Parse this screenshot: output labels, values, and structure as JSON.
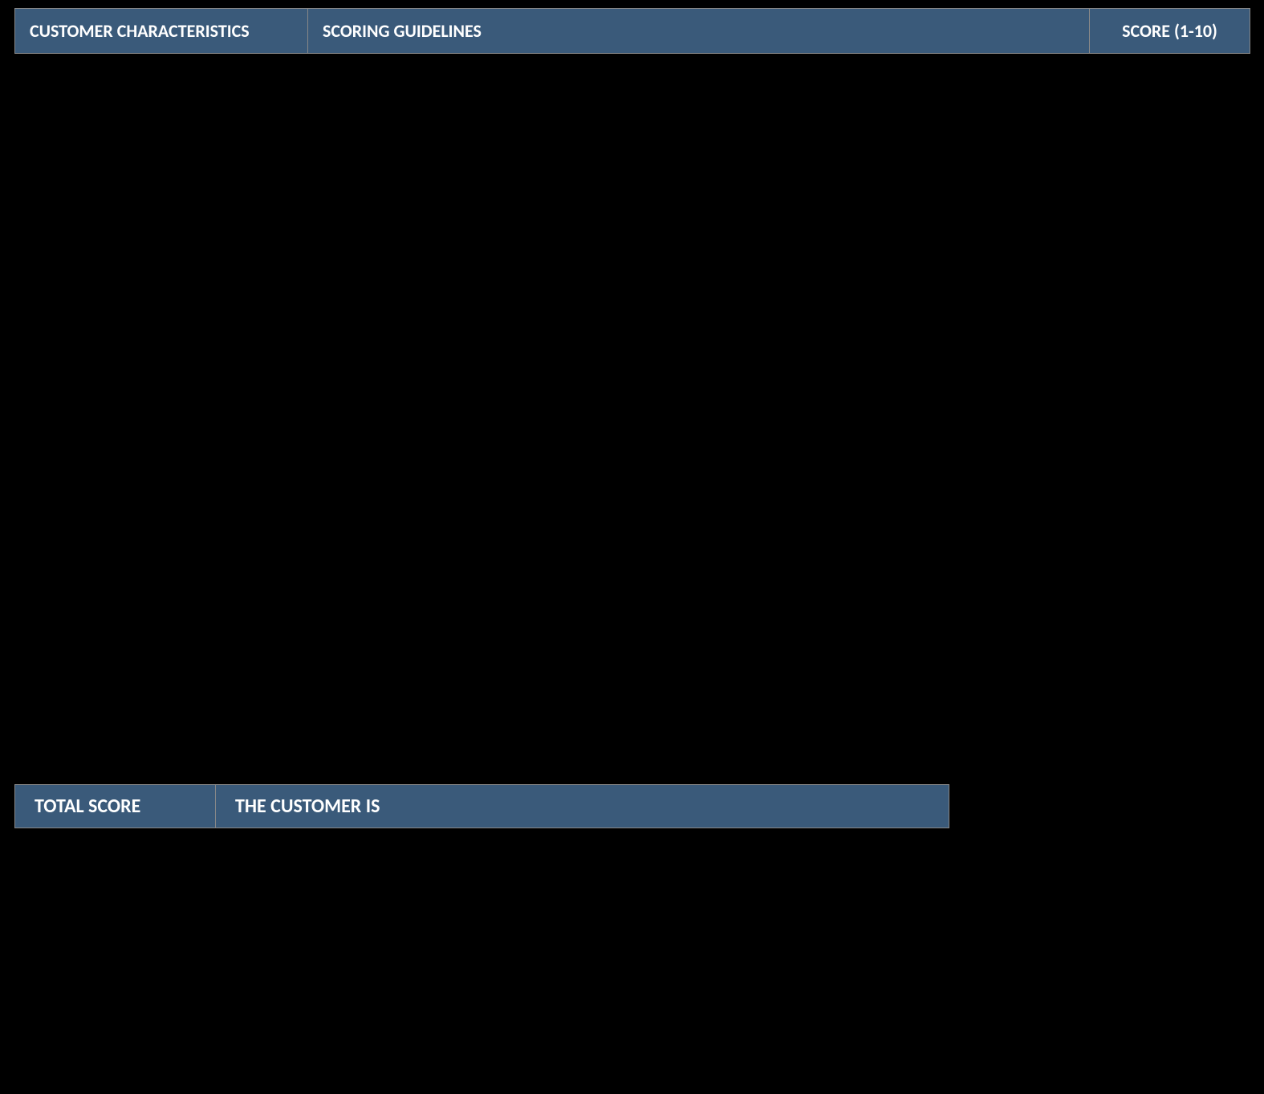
{
  "main_table": {
    "headers": {
      "characteristics": "CUSTOMER CHARACTERISTICS",
      "guidelines": "SCORING GUIDELINES",
      "score": "SCORE (1-10)"
    }
  },
  "score_table": {
    "headers": {
      "total_score": "TOTAL SCORE",
      "customer_is": "THE CUSTOMER IS"
    }
  },
  "colors": {
    "header_bg": "#3a5a7a",
    "header_text": "#ffffff",
    "body_bg": "#000000"
  }
}
